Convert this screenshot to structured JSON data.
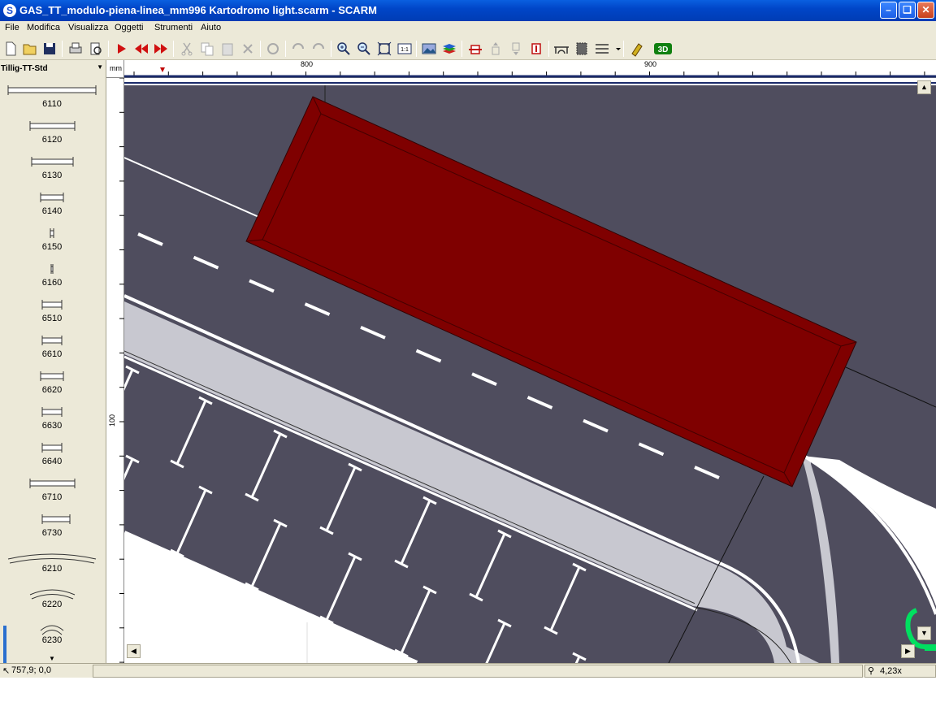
{
  "window": {
    "title": "GAS_TT_modulo-piena-linea_mm996 Kartodromo light.scarm - SCARM",
    "app_icon_letter": "S",
    "buttons": [
      "minimize-icon",
      "restore-icon",
      "close-icon"
    ]
  },
  "menu": [
    "File",
    "Modifica",
    "Visualizza",
    "Oggetti",
    "Strumenti",
    "Aiuto"
  ],
  "toolbar": {
    "icons": [
      "new-icon",
      "open-icon",
      "save-icon",
      "print-icon",
      "print-preview-icon",
      "play-icon",
      "rewind-icon",
      "forward-icon",
      "cut-icon",
      "copy-icon",
      "paste-icon",
      "delete-icon",
      "rotate-icon",
      "undo-icon",
      "redo-icon",
      "zoom-in-icon",
      "zoom-out-icon",
      "zoom-fit-icon",
      "zoom-1to1-icon",
      "background-icon",
      "layers-icon",
      "height-icon",
      "height-up-icon",
      "height-down-icon",
      "height-marker-icon",
      "bridge-icon",
      "tunnel-icon",
      "track-type-icon",
      "measure-icon",
      "view-3d-icon"
    ],
    "label_3d": "3D",
    "label_1to1": "1:1"
  },
  "library": {
    "selected": "Tillig-TT-Std",
    "items": [
      "6110",
      "6120",
      "6130",
      "6140",
      "6150",
      "6160",
      "6510",
      "6610",
      "6620",
      "6630",
      "6640",
      "6710",
      "6730",
      "6210",
      "6220",
      "6230"
    ]
  },
  "ruler": {
    "unit": "mm",
    "h_labels": [
      "800",
      "900"
    ],
    "v_labels": [
      "100"
    ]
  },
  "status": {
    "coords": "757,9; 0,0",
    "zoom": "4,23x"
  },
  "colors": {
    "road": "#4f4d5e",
    "building": "#7f0000",
    "sidewalk": "#c8c8d0",
    "marking": "#ffffff",
    "accent_green": "#00e060"
  }
}
